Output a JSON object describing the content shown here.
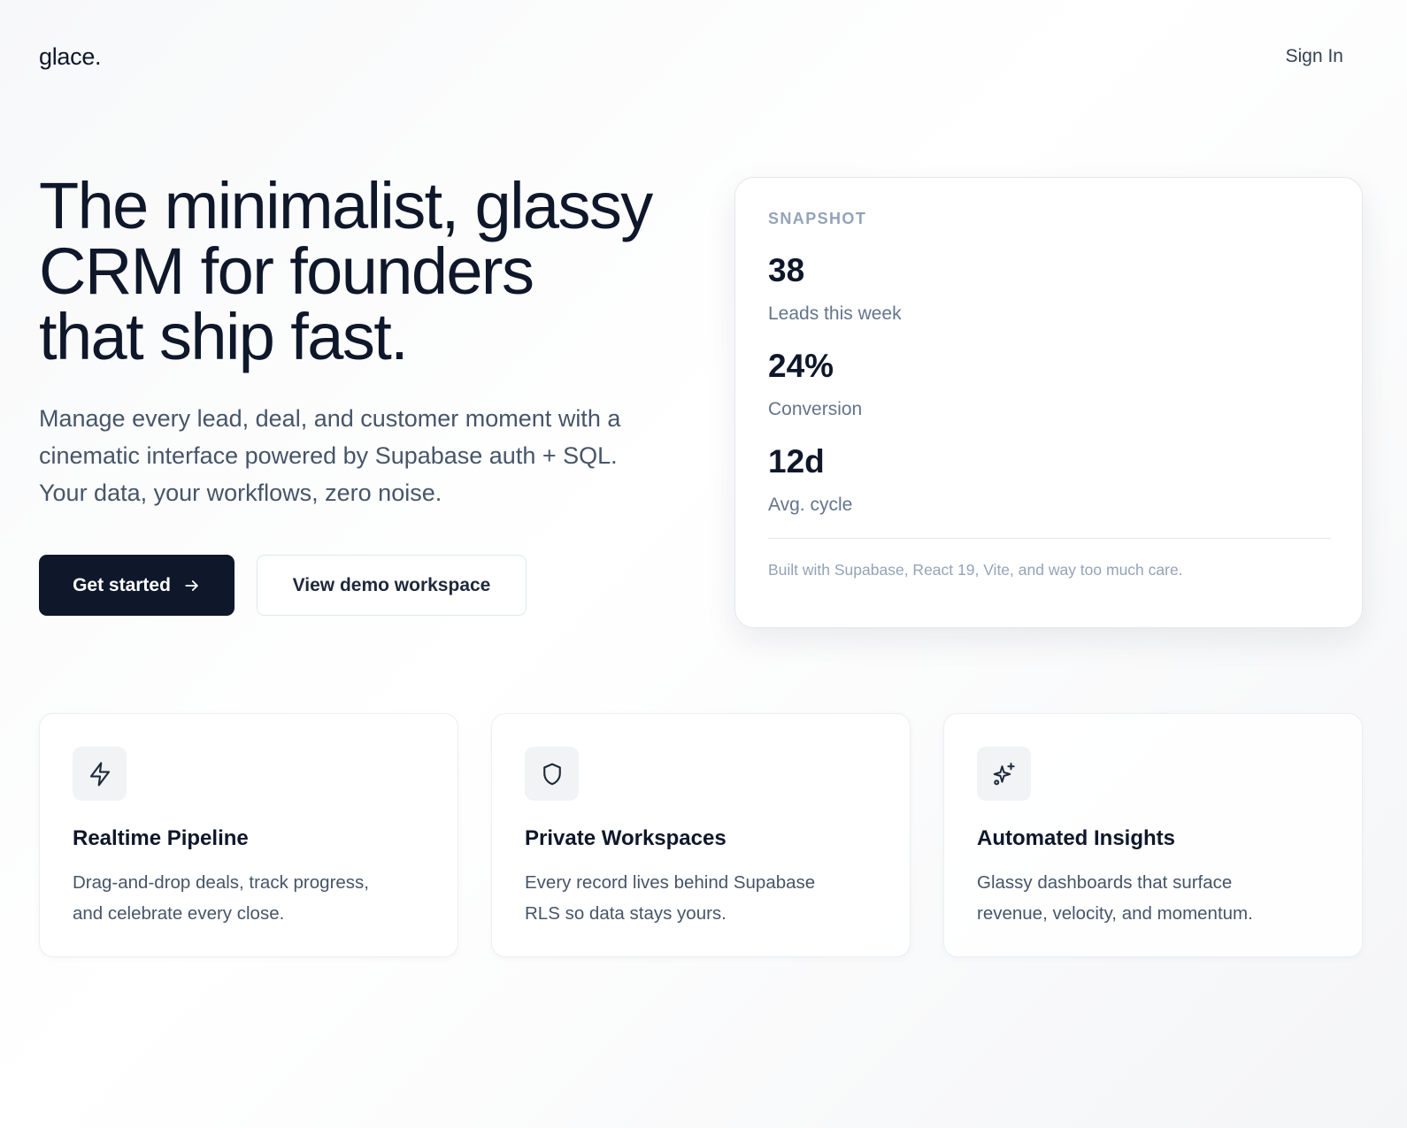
{
  "nav": {
    "logo": "glace.",
    "signin_label": "Sign In"
  },
  "hero": {
    "title_lines": [
      "The minimalist, glassy",
      "CRM for founders",
      "that ship fast."
    ],
    "subtitle_lines": [
      "Manage every lead, deal, and customer moment with a",
      "cinematic interface powered by Supabase auth + SQL.",
      "Your data, your workflows, zero noise."
    ],
    "primary_cta": "Get started",
    "secondary_cta": "View demo workspace"
  },
  "snapshot": {
    "label": "SNAPSHOT",
    "metrics": [
      {
        "value": "38",
        "label": "Leads this week"
      },
      {
        "value": "24%",
        "label": "Conversion"
      },
      {
        "value": "12d",
        "label": "Avg. cycle"
      }
    ],
    "footer": "Built with Supabase, React 19, Vite, and way too much care."
  },
  "features": [
    {
      "icon": "lightning-icon",
      "title": "Realtime Pipeline",
      "desc_lines": [
        "Drag-and-drop deals, track progress,",
        "and celebrate every close."
      ]
    },
    {
      "icon": "shield-icon",
      "title": "Private Workspaces",
      "desc_lines": [
        "Every record lives behind Supabase",
        "RLS so data stays yours."
      ]
    },
    {
      "icon": "sparkles-icon",
      "title": "Automated Insights",
      "desc_lines": [
        "Glassy dashboards that surface",
        "revenue, velocity, and momentum."
      ]
    }
  ],
  "colors": {
    "primary": "#0f172a",
    "muted": "#64748b",
    "border": "#e5e7eb"
  }
}
